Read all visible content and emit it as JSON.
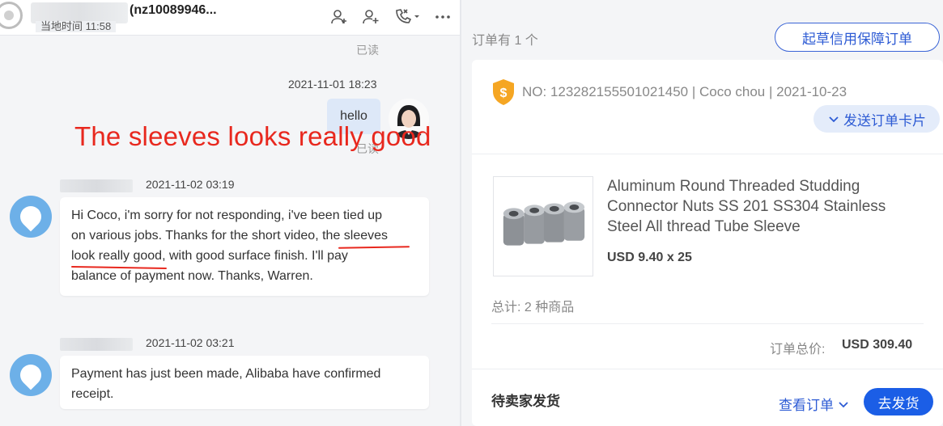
{
  "chat": {
    "header": {
      "contact_name": "(nz10089946...",
      "subtitle": "当地时间 11:58",
      "icons": [
        "add-contact-icon",
        "add-member-icon",
        "call-icon",
        "more-icon"
      ]
    },
    "read_label": "已读",
    "overlay_annotation": "The sleeves looks really good",
    "messages": [
      {
        "direction": "out",
        "timestamp": "2021-11-01 18:23",
        "text": "hello",
        "status": "已读"
      },
      {
        "direction": "in",
        "timestamp": "2021-11-02 03:19",
        "lines": [
          "Hi Coco, i'm sorry for not responding, i've been tied up",
          "on various jobs. Thanks for the short video, the sleeves",
          "look really good, with good surface finish. I'll pay",
          "balance of payment now. Thanks, Warren."
        ]
      },
      {
        "direction": "in",
        "timestamp": "2021-11-02 03:21",
        "lines": [
          "Payment has just been made, Alibaba have confirmed",
          "receipt."
        ]
      }
    ]
  },
  "order": {
    "count_label": "订单有 1 个",
    "draft_button": "起草信用保障订单",
    "order_line": "NO: 123282155501021450 | Coco chou | 2021-10-23",
    "send_card_button": "发送订单卡片",
    "product": {
      "title": "Aluminum Round Threaded Studding Connector Nuts SS 201 SS304 Stainless Steel All thread Tube Sleeve",
      "price": "USD 9.40 x 25"
    },
    "total_items": "总计: 2 种商品",
    "total_label": "订单总价:",
    "total_value": "USD 309.40",
    "status": "待卖家发货",
    "view_order": "查看订单",
    "ship_button": "去发货",
    "colors": {
      "accent": "#2d5bd4",
      "primary_button": "#1b5ee6",
      "annotation_red": "#e8281e"
    }
  }
}
